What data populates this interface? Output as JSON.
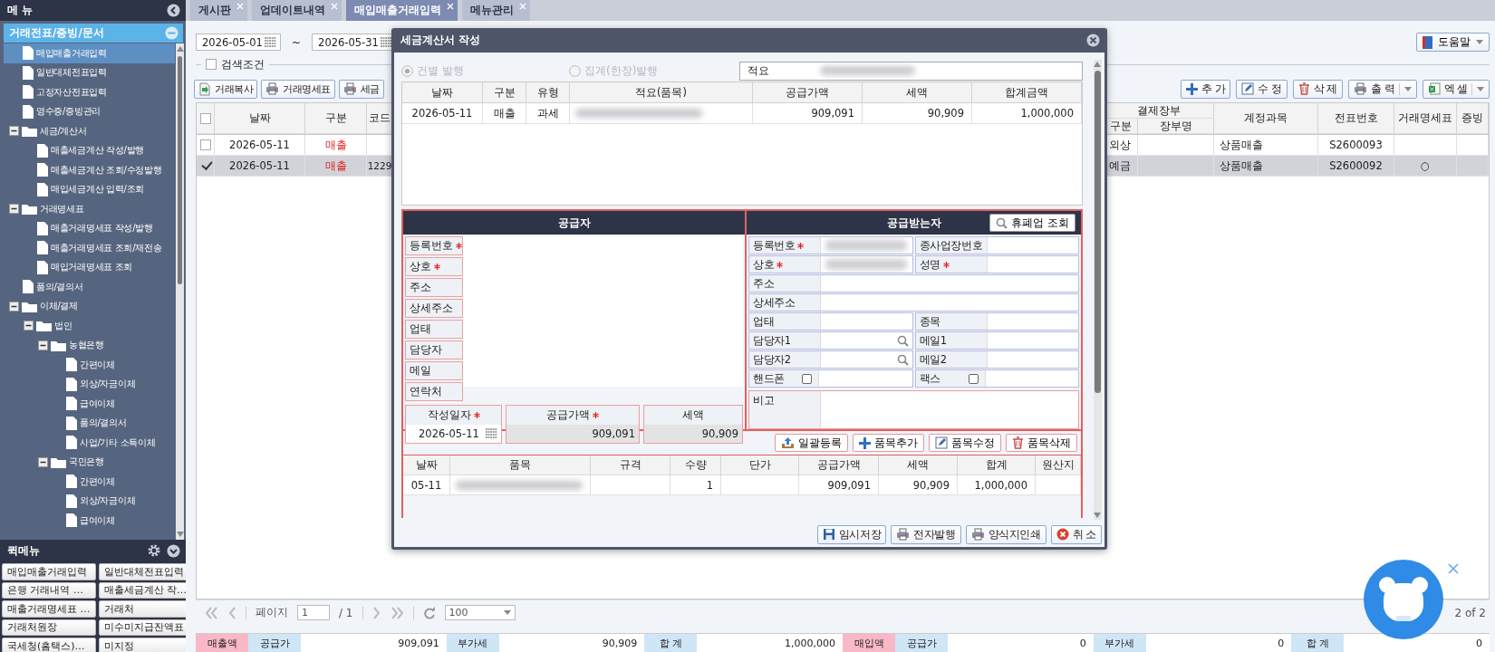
{
  "sidebar": {
    "title": "메 뉴",
    "section": "거래전표/증빙/문서",
    "tree": [
      {
        "label": "매입매출거래입력",
        "kind": "file",
        "selected": true
      },
      {
        "label": "일반대체전표입력",
        "kind": "file",
        "selected": false
      },
      {
        "label": "고정자산전표입력",
        "kind": "file",
        "selected": false
      },
      {
        "label": "영수증/증빙관리",
        "kind": "file",
        "selected": false
      },
      {
        "label": "세금/계산서",
        "kind": "folder",
        "selected": false,
        "expanded": true,
        "children": [
          {
            "label": "매출세금계산 작성/발행",
            "kind": "file",
            "selected": false
          },
          {
            "label": "매출세금계산 조회/수정발행",
            "kind": "file",
            "selected": false
          },
          {
            "label": "매입세금계산 입력/조회",
            "kind": "file",
            "selected": false
          }
        ]
      },
      {
        "label": "거래명세표",
        "kind": "folder",
        "selected": false,
        "expanded": true,
        "children": [
          {
            "label": "매출거래명세표 작성/발행",
            "kind": "file",
            "selected": false
          },
          {
            "label": "매출거래명세표 조회/재전송",
            "kind": "file",
            "selected": false
          },
          {
            "label": "매입거래명세표 조회",
            "kind": "file",
            "selected": false
          }
        ]
      },
      {
        "label": "품의/결의서",
        "kind": "file",
        "selected": false
      },
      {
        "label": "이체/결제",
        "kind": "folder",
        "selected": false,
        "expanded": true,
        "children": [
          {
            "label": "법인",
            "kind": "folder",
            "selected": false,
            "expanded": true,
            "children": [
              {
                "label": "농협은행",
                "kind": "folder",
                "selected": false,
                "expanded": true,
                "children": [
                  {
                    "label": "간편이체",
                    "kind": "file",
                    "selected": false
                  },
                  {
                    "label": "외상/자금이체",
                    "kind": "file",
                    "selected": false
                  },
                  {
                    "label": "급여이체",
                    "kind": "file",
                    "selected": false
                  },
                  {
                    "label": "품의/결의서",
                    "kind": "file",
                    "selected": false
                  },
                  {
                    "label": "사업/기타 소득이체",
                    "kind": "file",
                    "selected": false
                  }
                ]
              },
              {
                "label": "국민은행",
                "kind": "folder",
                "selected": false,
                "expanded": true,
                "children": [
                  {
                    "label": "간편이체",
                    "kind": "file",
                    "selected": false
                  },
                  {
                    "label": "외상/자금이체",
                    "kind": "file",
                    "selected": false
                  },
                  {
                    "label": "급여이체",
                    "kind": "file",
                    "selected": false
                  }
                ]
              }
            ]
          }
        ]
      }
    ]
  },
  "quick_menu": {
    "title": "퀵메뉴",
    "items": [
      "매입매출거래입력",
      "일반대체전표입력",
      "은행 거래내역 …",
      "매출세금계산 작…",
      "매출거래명세표 …",
      "거래처",
      "거래처원장",
      "미수미지급잔액표",
      "국세청(홈택스)…",
      "미지정"
    ]
  },
  "tabs": [
    {
      "label": "게시판",
      "selected": false
    },
    {
      "label": "업데이트내역",
      "selected": false
    },
    {
      "label": "매입매출거래입력",
      "selected": true
    },
    {
      "label": "메뉴관리",
      "selected": false
    }
  ],
  "filter": {
    "date_from": "2026-05-01",
    "separator": "~",
    "date_to": "2026-05-31",
    "search_toggle": {
      "label": "검색조건",
      "checked": false
    }
  },
  "help_button": "도움말",
  "toolbar_left": [
    {
      "label": "거래복사",
      "kind": "copy"
    },
    {
      "label": "거래명세표",
      "kind": "print"
    },
    {
      "label": "세금",
      "kind": "print"
    }
  ],
  "toolbar_right": [
    {
      "label": "추 가",
      "kind": "plus",
      "dropdown": false
    },
    {
      "label": "수 정",
      "kind": "edit",
      "dropdown": false
    },
    {
      "label": "삭 제",
      "kind": "delete",
      "dropdown": false
    },
    {
      "label": "출 력",
      "kind": "print",
      "dropdown": true
    },
    {
      "label": "엑 셀",
      "kind": "excel",
      "dropdown": true
    }
  ],
  "table": {
    "select_all": {
      "checked": false
    },
    "columns_left": [
      "날짜",
      "구분",
      "코드"
    ],
    "group": {
      "label": "결제장부",
      "columns": [
        "구분",
        "장부명"
      ]
    },
    "columns_right": [
      "계정과목",
      "전표번호",
      "거래명세표",
      "증빙"
    ],
    "rows": [
      {
        "selected": false,
        "checked": false,
        "date": "2026-05-11",
        "division": "매출",
        "payment": "외상",
        "account": "상품매출",
        "voucher": "S2600093"
      },
      {
        "selected": true,
        "checked": true,
        "date": "2026-05-11",
        "division": "매출",
        "code": "1229",
        "payment": "예금",
        "account": "상품매출",
        "voucher": "S2600092",
        "statement": "○"
      }
    ]
  },
  "pager": {
    "label": "페이지",
    "page": "1",
    "total": "/ 1",
    "page_size": "100",
    "count": "2 of 2"
  },
  "summary": [
    {
      "label": "매출액",
      "items": [
        {
          "label": "공급가",
          "value": "909,091"
        },
        {
          "label": "부가세",
          "value": "90,909"
        },
        {
          "label": "합 계",
          "value": "1,000,000"
        }
      ]
    },
    {
      "label": "매입액",
      "items": [
        {
          "label": "공급가",
          "value": "0"
        },
        {
          "label": "부가세",
          "value": "0"
        },
        {
          "label": "합 계",
          "value": "0"
        }
      ]
    }
  ],
  "dialog": {
    "title": "세금계산서 작성",
    "issue_options": [
      {
        "label": "건별 발행",
        "selected": true,
        "disabled": true
      },
      {
        "label": "집계(한장)발행",
        "selected": false,
        "disabled": true
      }
    ],
    "memo_label": "적요",
    "items_table": {
      "columns": [
        "날짜",
        "구분",
        "유형",
        "적요(품목)",
        "공급가액",
        "세액",
        "합계금액"
      ],
      "rows": [
        {
          "date": "2026-05-11",
          "division": "매출",
          "type": "과세",
          "supply": "909,091",
          "tax": "90,909",
          "total": "1,000,000"
        }
      ]
    },
    "supplier": {
      "title": "공급자",
      "fields": [
        {
          "label": "등록번호",
          "required": true
        },
        {
          "label": "상호",
          "required": true
        },
        {
          "label": "주소",
          "required": false
        },
        {
          "label": "상세주소",
          "required": false
        },
        {
          "label": "업태",
          "required": false
        },
        {
          "label": "담당자",
          "required": false
        },
        {
          "label": "메일",
          "required": false
        },
        {
          "label": "연락처",
          "required": false
        }
      ],
      "totals": [
        {
          "label": "작성일자",
          "required": true,
          "value": "2026-05-11",
          "kind": "date"
        },
        {
          "label": "공급가액",
          "required": true,
          "value": "909,091",
          "kind": "amount"
        },
        {
          "label": "세액",
          "required": false,
          "value": "90,909",
          "kind": "amount"
        }
      ]
    },
    "receiver": {
      "title": "공급받는자",
      "lookup_button": "휴폐업 조회",
      "rows": [
        [
          {
            "label": "등록번호",
            "required": true,
            "kind": "redacted"
          },
          {
            "label": "종사업장번호",
            "required": false,
            "kind": "text"
          }
        ],
        [
          {
            "label": "상호",
            "required": true,
            "kind": "redacted"
          },
          {
            "label": "성명",
            "required": true,
            "kind": "text"
          }
        ],
        [
          {
            "label": "주소",
            "required": false,
            "kind": "text"
          }
        ],
        [
          {
            "label": "상세주소",
            "required": false,
            "kind": "text"
          }
        ],
        [
          {
            "label": "업태",
            "required": false,
            "kind": "text"
          },
          {
            "label": "종목",
            "required": false,
            "kind": "text"
          }
        ],
        [
          {
            "label": "담당자1",
            "required": false,
            "kind": "search"
          },
          {
            "label": "메일1",
            "required": false,
            "kind": "text"
          }
        ],
        [
          {
            "label": "담당자2",
            "required": false,
            "kind": "search"
          },
          {
            "label": "메일2",
            "required": false,
            "kind": "text"
          }
        ],
        [
          {
            "label": "핸드폰",
            "required": false,
            "kind": "check",
            "checked": false
          },
          {
            "label": "팩스",
            "required": false,
            "kind": "check",
            "checked": false
          }
        ]
      ],
      "note_label": "비고"
    },
    "item_buttons": [
      {
        "label": "일괄등록",
        "kind": "upload"
      },
      {
        "label": "품목추가",
        "kind": "plus"
      },
      {
        "label": "품목수정",
        "kind": "edit"
      },
      {
        "label": "품목삭제",
        "kind": "delete"
      }
    ],
    "lines_table": {
      "columns": [
        "날짜",
        "품목",
        "규격",
        "수량",
        "단가",
        "공급가액",
        "세액",
        "합계",
        "원산지"
      ],
      "rows": [
        {
          "date": "05-11",
          "qty": "1",
          "supply": "909,091",
          "tax": "90,909",
          "total": "1,000,000"
        }
      ]
    },
    "footer_buttons": [
      {
        "label": "임시저장",
        "kind": "save"
      },
      {
        "label": "전자발행",
        "kind": "print"
      },
      {
        "label": "양식지인쇄",
        "kind": "print"
      },
      {
        "label": "취 소",
        "kind": "cancel"
      }
    ]
  }
}
